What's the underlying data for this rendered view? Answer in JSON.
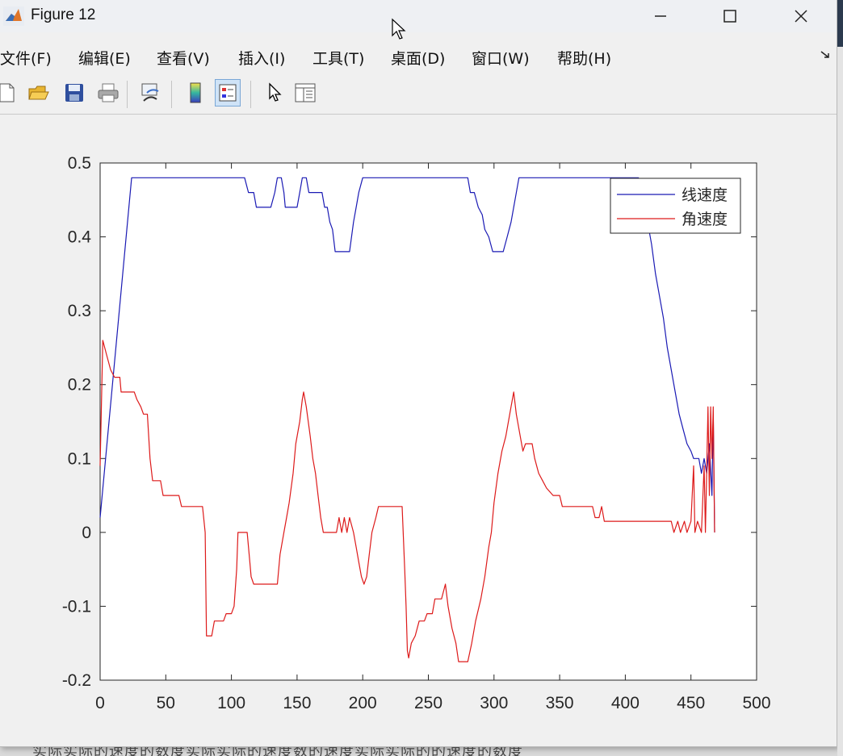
{
  "window": {
    "title": "Figure 12"
  },
  "menu": {
    "items": [
      {
        "label": "文件(F)",
        "name": "menu-file"
      },
      {
        "label": "编辑(E)",
        "name": "menu-edit"
      },
      {
        "label": "查看(V)",
        "name": "menu-view"
      },
      {
        "label": "插入(I)",
        "name": "menu-insert"
      },
      {
        "label": "工具(T)",
        "name": "menu-tools"
      },
      {
        "label": "桌面(D)",
        "name": "menu-desktop"
      },
      {
        "label": "窗口(W)",
        "name": "menu-window"
      },
      {
        "label": "帮助(H)",
        "name": "menu-help"
      }
    ]
  },
  "toolbar": {
    "icons": [
      "new-file-icon",
      "open-folder-icon",
      "save-icon",
      "print-icon",
      "link-plot-icon",
      "colorbar-icon",
      "legend-icon",
      "pointer-icon",
      "property-editor-icon"
    ]
  },
  "colors": {
    "line_speed": "#1a1ab4",
    "angular_speed": "#dd1a1a"
  },
  "chart_data": {
    "type": "line",
    "xlim": [
      0,
      500
    ],
    "ylim": [
      -0.2,
      0.5
    ],
    "xticks": [
      0,
      50,
      100,
      150,
      200,
      250,
      300,
      350,
      400,
      450,
      500
    ],
    "yticks": [
      -0.2,
      -0.1,
      0,
      0.1,
      0.2,
      0.3,
      0.4,
      0.5
    ],
    "xtick_labels": [
      "0",
      "50",
      "100",
      "150",
      "200",
      "250",
      "300",
      "350",
      "400",
      "450",
      "500"
    ],
    "ytick_labels": [
      "-0.2",
      "-0.1",
      "0",
      "0.1",
      "0.2",
      "0.3",
      "0.4",
      "0.5"
    ],
    "grid": false,
    "legend_position": "top-right",
    "series": [
      {
        "name": "线速度",
        "color": "#1a1ab4",
        "points": [
          [
            0,
            0.02
          ],
          [
            24,
            0.48
          ],
          [
            110,
            0.48
          ],
          [
            113,
            0.46
          ],
          [
            117,
            0.46
          ],
          [
            119,
            0.44
          ],
          [
            130,
            0.44
          ],
          [
            133,
            0.46
          ],
          [
            135,
            0.48
          ],
          [
            138,
            0.48
          ],
          [
            140,
            0.46
          ],
          [
            141,
            0.44
          ],
          [
            150,
            0.44
          ],
          [
            152,
            0.46
          ],
          [
            154,
            0.48
          ],
          [
            157,
            0.48
          ],
          [
            159,
            0.46
          ],
          [
            169,
            0.46
          ],
          [
            171,
            0.44
          ],
          [
            173,
            0.44
          ],
          [
            175,
            0.42
          ],
          [
            177,
            0.41
          ],
          [
            179,
            0.38
          ],
          [
            190,
            0.38
          ],
          [
            193,
            0.42
          ],
          [
            195,
            0.44
          ],
          [
            197,
            0.46
          ],
          [
            200,
            0.48
          ],
          [
            280,
            0.48
          ],
          [
            282,
            0.46
          ],
          [
            285,
            0.46
          ],
          [
            288,
            0.44
          ],
          [
            291,
            0.43
          ],
          [
            293,
            0.41
          ],
          [
            296,
            0.4
          ],
          [
            299,
            0.38
          ],
          [
            307,
            0.38
          ],
          [
            310,
            0.4
          ],
          [
            313,
            0.42
          ],
          [
            316,
            0.45
          ],
          [
            319,
            0.48
          ],
          [
            410,
            0.48
          ],
          [
            412,
            0.47
          ],
          [
            414,
            0.45
          ],
          [
            417,
            0.42
          ],
          [
            420,
            0.39
          ],
          [
            423,
            0.35
          ],
          [
            426,
            0.32
          ],
          [
            429,
            0.29
          ],
          [
            432,
            0.25
          ],
          [
            435,
            0.22
          ],
          [
            438,
            0.19
          ],
          [
            441,
            0.16
          ],
          [
            444,
            0.14
          ],
          [
            447,
            0.12
          ],
          [
            450,
            0.11
          ],
          [
            452,
            0.1
          ],
          [
            456,
            0.1
          ],
          [
            458,
            0.08
          ],
          [
            460,
            0.1
          ],
          [
            462,
            0.08
          ],
          [
            464,
            0.12
          ],
          [
            466,
            0.05
          ],
          [
            467,
            0.16
          ],
          [
            468,
            0.0
          ]
        ]
      },
      {
        "name": "角速度",
        "color": "#dd1a1a",
        "points": [
          [
            0,
            0.09
          ],
          [
            2,
            0.26
          ],
          [
            5,
            0.24
          ],
          [
            8,
            0.22
          ],
          [
            11,
            0.21
          ],
          [
            15,
            0.21
          ],
          [
            16,
            0.19
          ],
          [
            26,
            0.19
          ],
          [
            28,
            0.18
          ],
          [
            31,
            0.17
          ],
          [
            33,
            0.16
          ],
          [
            36,
            0.16
          ],
          [
            38,
            0.1
          ],
          [
            40,
            0.07
          ],
          [
            46,
            0.07
          ],
          [
            48,
            0.05
          ],
          [
            60,
            0.05
          ],
          [
            62,
            0.035
          ],
          [
            78,
            0.035
          ],
          [
            80,
            0.0
          ],
          [
            81,
            -0.14
          ],
          [
            85,
            -0.14
          ],
          [
            87,
            -0.12
          ],
          [
            94,
            -0.12
          ],
          [
            96,
            -0.11
          ],
          [
            100,
            -0.11
          ],
          [
            102,
            -0.1
          ],
          [
            104,
            -0.05
          ],
          [
            105,
            0.0
          ],
          [
            112,
            0.0
          ],
          [
            114,
            -0.04
          ],
          [
            115,
            -0.06
          ],
          [
            117,
            -0.07
          ],
          [
            135,
            -0.07
          ],
          [
            137,
            -0.03
          ],
          [
            140,
            0.0
          ],
          [
            142,
            0.02
          ],
          [
            144,
            0.04
          ],
          [
            147,
            0.08
          ],
          [
            149,
            0.12
          ],
          [
            152,
            0.15
          ],
          [
            154,
            0.18
          ],
          [
            155,
            0.19
          ],
          [
            157,
            0.17
          ],
          [
            160,
            0.13
          ],
          [
            162,
            0.1
          ],
          [
            164,
            0.08
          ],
          [
            166,
            0.05
          ],
          [
            168,
            0.02
          ],
          [
            170,
            0.0
          ],
          [
            180,
            0.0
          ],
          [
            182,
            0.02
          ],
          [
            184,
            0.0
          ],
          [
            186,
            0.02
          ],
          [
            188,
            0.0
          ],
          [
            190,
            0.02
          ],
          [
            193,
            0.0
          ],
          [
            195,
            -0.02
          ],
          [
            197,
            -0.04
          ],
          [
            199,
            -0.06
          ],
          [
            201,
            -0.07
          ],
          [
            203,
            -0.06
          ],
          [
            205,
            -0.03
          ],
          [
            207,
            0.0
          ],
          [
            210,
            0.02
          ],
          [
            212,
            0.035
          ],
          [
            230,
            0.035
          ],
          [
            232,
            -0.05
          ],
          [
            233,
            -0.1
          ],
          [
            234,
            -0.16
          ],
          [
            235,
            -0.17
          ],
          [
            237,
            -0.15
          ],
          [
            240,
            -0.14
          ],
          [
            243,
            -0.12
          ],
          [
            247,
            -0.12
          ],
          [
            249,
            -0.11
          ],
          [
            253,
            -0.11
          ],
          [
            255,
            -0.09
          ],
          [
            260,
            -0.09
          ],
          [
            263,
            -0.07
          ],
          [
            265,
            -0.1
          ],
          [
            268,
            -0.13
          ],
          [
            271,
            -0.15
          ],
          [
            273,
            -0.175
          ],
          [
            280,
            -0.175
          ],
          [
            283,
            -0.15
          ],
          [
            286,
            -0.12
          ],
          [
            290,
            -0.09
          ],
          [
            293,
            -0.06
          ],
          [
            296,
            -0.02
          ],
          [
            298,
            0.0
          ],
          [
            300,
            0.04
          ],
          [
            303,
            0.08
          ],
          [
            306,
            0.11
          ],
          [
            309,
            0.13
          ],
          [
            313,
            0.17
          ],
          [
            315,
            0.19
          ],
          [
            317,
            0.16
          ],
          [
            320,
            0.13
          ],
          [
            322,
            0.11
          ],
          [
            324,
            0.12
          ],
          [
            329,
            0.12
          ],
          [
            331,
            0.1
          ],
          [
            334,
            0.08
          ],
          [
            337,
            0.07
          ],
          [
            340,
            0.06
          ],
          [
            345,
            0.05
          ],
          [
            350,
            0.05
          ],
          [
            352,
            0.035
          ],
          [
            375,
            0.035
          ],
          [
            377,
            0.02
          ],
          [
            380,
            0.02
          ],
          [
            382,
            0.035
          ],
          [
            384,
            0.015
          ],
          [
            435,
            0.015
          ],
          [
            437,
            0.0
          ],
          [
            440,
            0.015
          ],
          [
            442,
            0.0
          ],
          [
            445,
            0.015
          ],
          [
            447,
            0.0
          ],
          [
            450,
            0.015
          ],
          [
            452,
            0.09
          ],
          [
            453,
            0.0
          ],
          [
            455,
            0.015
          ],
          [
            458,
            0.0
          ],
          [
            460,
            0.09
          ],
          [
            461,
            0.0
          ],
          [
            463,
            0.17
          ],
          [
            464,
            0.05
          ],
          [
            465,
            0.17
          ],
          [
            466,
            0.1
          ],
          [
            467,
            0.17
          ],
          [
            468,
            0.0
          ]
        ]
      }
    ]
  },
  "background_text": "实际实际的速度的数度实际实际的速度数的速度实际实际的的速度的数度"
}
